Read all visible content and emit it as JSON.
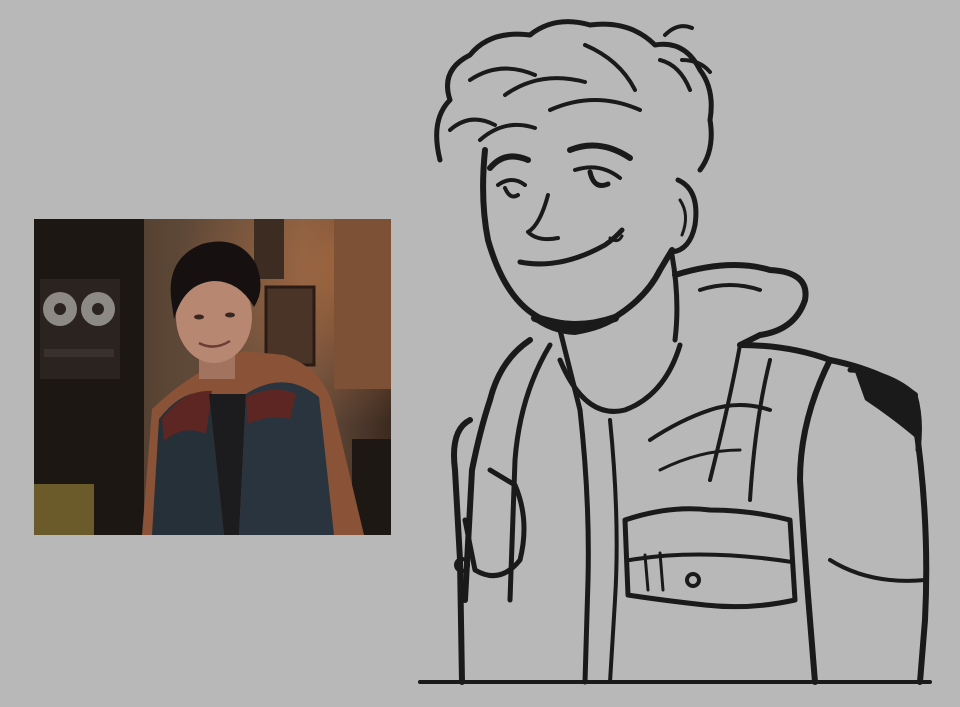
{
  "colors": {
    "background": "#b8b8b8",
    "ink": "#1a1a1a",
    "photo_wall": "#5e4433",
    "photo_shadow": "#241914",
    "jacket_orange": "#9a5d3e",
    "vest_blue": "#27303a",
    "vest_red": "#6a2a25",
    "hair": "#1a1412",
    "skin": "#b88771"
  },
  "icons": {
    "photo": "reference-photo",
    "drawing": "line-art-sketch"
  }
}
